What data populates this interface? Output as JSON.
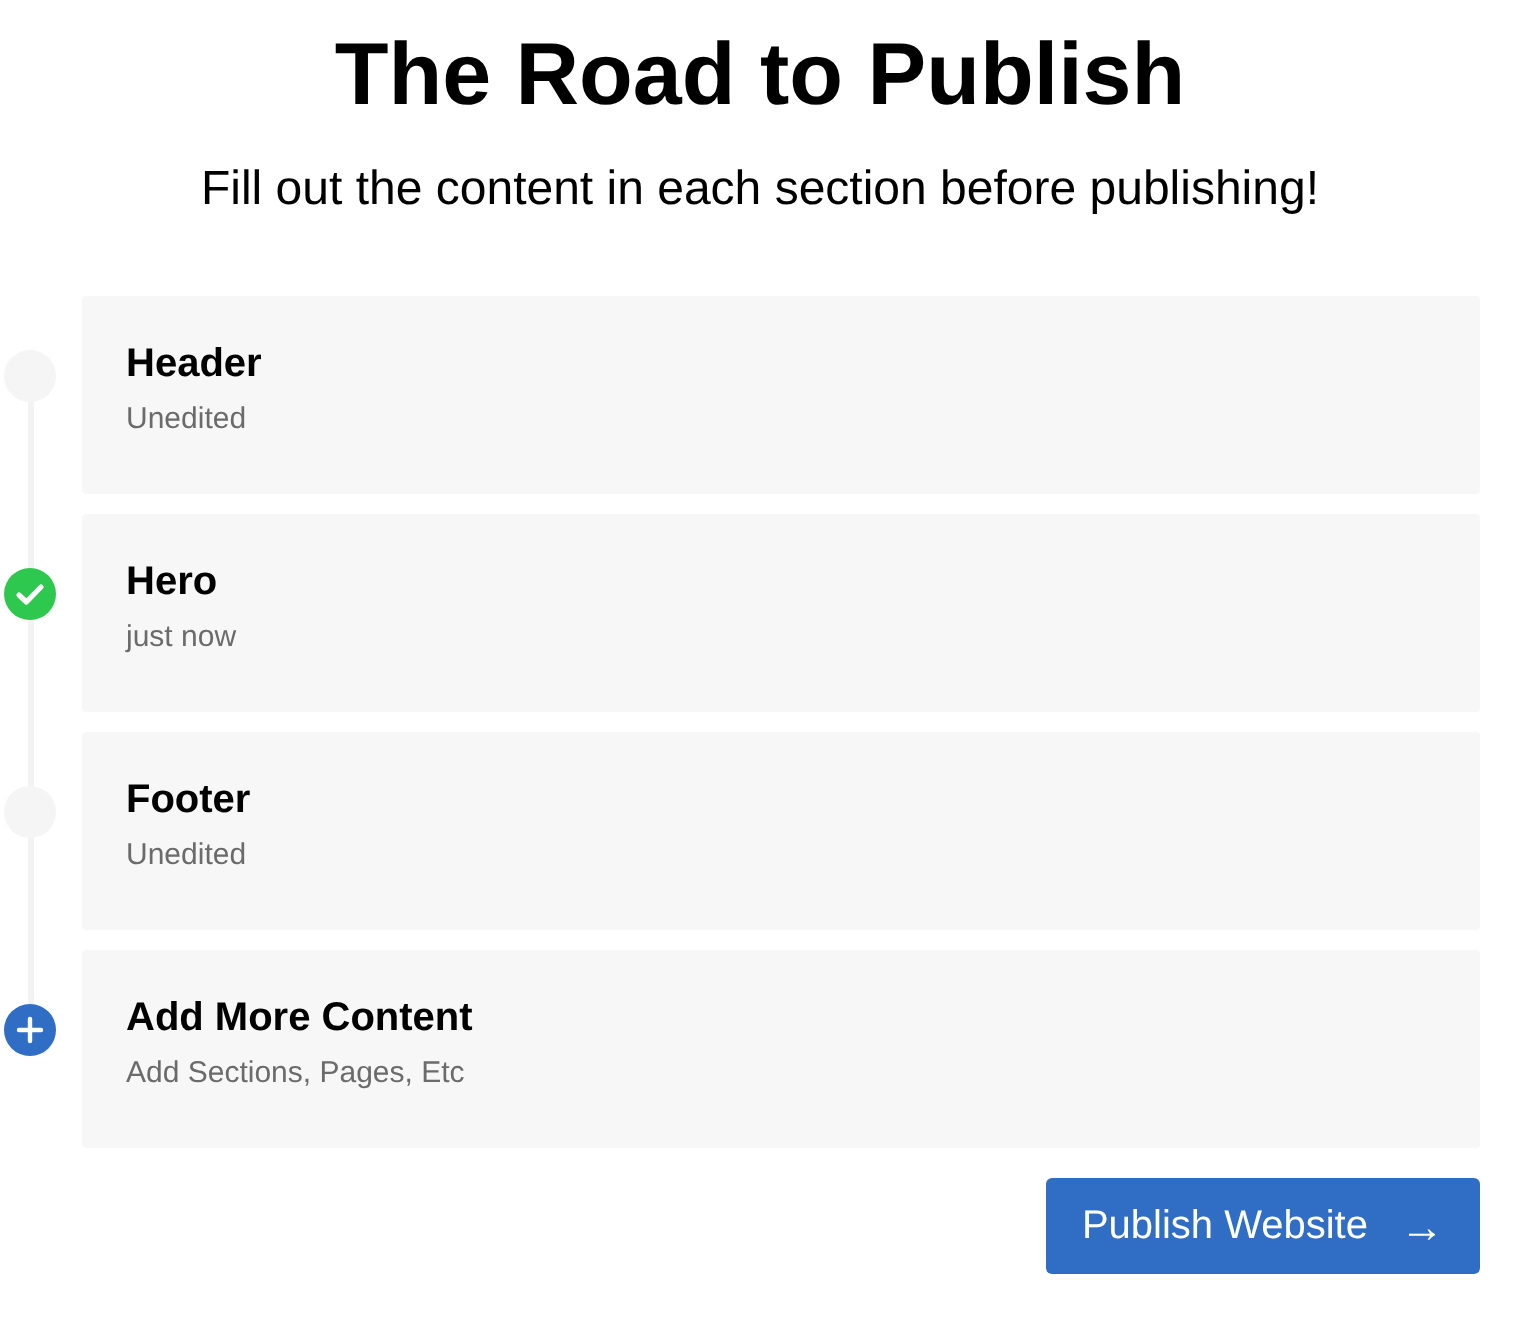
{
  "title": "The Road to Publish",
  "subtitle": "Fill out the content in each section before publishing!",
  "steps": [
    {
      "kind": "pending",
      "title": "Header",
      "status": "Unedited"
    },
    {
      "kind": "done",
      "title": "Hero",
      "status": "just now"
    },
    {
      "kind": "pending",
      "title": "Footer",
      "status": "Unedited"
    },
    {
      "kind": "add",
      "title": "Add More Content",
      "status": "Add Sections, Pages, Etc"
    }
  ],
  "button": {
    "label": "Publish Website",
    "icon": "→"
  }
}
